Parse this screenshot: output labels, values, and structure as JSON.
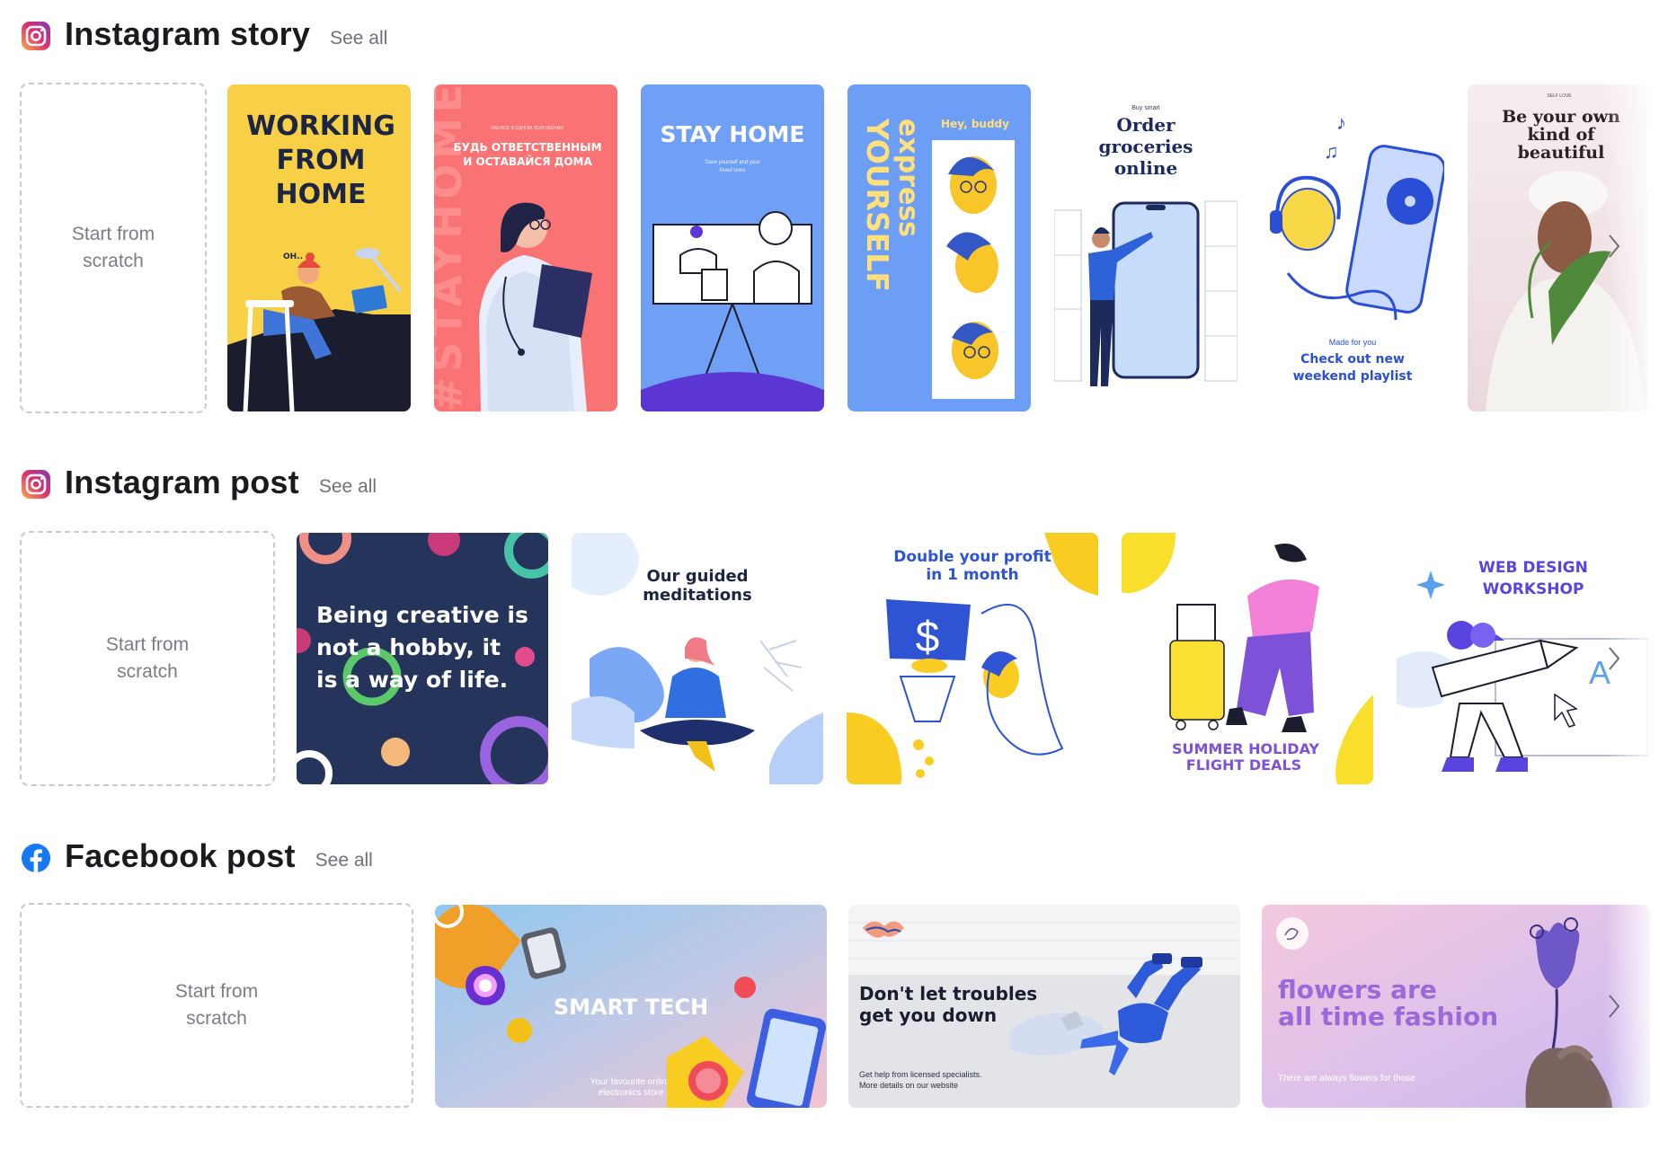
{
  "sections": {
    "story": {
      "title": "Instagram story",
      "see_all": "See all",
      "scratch_line1": "Start from",
      "scratch_line2": "scratch",
      "cards": {
        "working": {
          "line1": "WORKING",
          "line2": "FROM",
          "line3": "HOME",
          "exclaim": "OH.."
        },
        "stayhome_ru": {
          "vertical": "#STAYHOME",
          "small": "МЫ ВСЕ В ОДНОМ ПОЛОЖЕНИИ",
          "line1": "БУДЬ ОТВЕТСТВЕННЫМ",
          "line2": "И ОСТАВАЙСЯ ДОМА"
        },
        "stay_home": {
          "title": "STAY HOME",
          "sub1": "Save yourself and your",
          "sub2": "loved ones"
        },
        "express": {
          "word1": "express",
          "word2": "YOURSELF",
          "hey": "Hey, buddy"
        },
        "groceries": {
          "small": "Buy smart",
          "line1": "Order",
          "line2": "groceries",
          "line3": "online"
        },
        "playlist": {
          "small": "Made for you",
          "line1": "Check out new",
          "line2": "weekend playlist"
        },
        "beauty": {
          "small": "SELF LOVE",
          "line1": "Be your own",
          "line2": "kind of",
          "line3": "beautiful"
        }
      }
    },
    "post": {
      "title": "Instagram post",
      "see_all": "See all",
      "scratch_line1": "Start from",
      "scratch_line2": "scratch",
      "cards": {
        "creative": {
          "line1": "Being creative is",
          "line2": "not a hobby, it",
          "line3": "is a way of life."
        },
        "meditation": {
          "line1": "Our guided",
          "line2": "meditations"
        },
        "profit": {
          "line1": "Double your profit",
          "line2": "in 1 month"
        },
        "holiday": {
          "line1": "SUMMER HOLIDAY",
          "line2": "FLIGHT DEALS"
        },
        "webdesign": {
          "line1": "WEB DESIGN",
          "line2": "WORKSHOP"
        }
      }
    },
    "facebook": {
      "title": "Facebook post",
      "see_all": "See all",
      "scratch_line1": "Start from",
      "scratch_line2": "scratch",
      "cards": {
        "smarttech": {
          "title": "SMART TECH",
          "sub1": "Your favourite online",
          "sub2": "electronics store"
        },
        "troubles": {
          "line1": "Don't let troubles",
          "line2": "get you down",
          "sub1": "Get help from licensed specialists.",
          "sub2": "More details on our website"
        },
        "flowers": {
          "line1": "flowers are",
          "line2": "all time fashion",
          "sub": "There are always flowers for those"
        }
      }
    }
  },
  "colors": {
    "instagram_gradient": [
      "#fbad50",
      "#e1306c",
      "#833ab4"
    ],
    "facebook_blue": "#1877f2",
    "see_all_gray": "#6f7079",
    "dashed_border": "#c8cad0"
  },
  "icons": {
    "story": "instagram-icon",
    "post": "instagram-icon",
    "facebook": "facebook-icon",
    "nav": "chevron-right-icon"
  }
}
